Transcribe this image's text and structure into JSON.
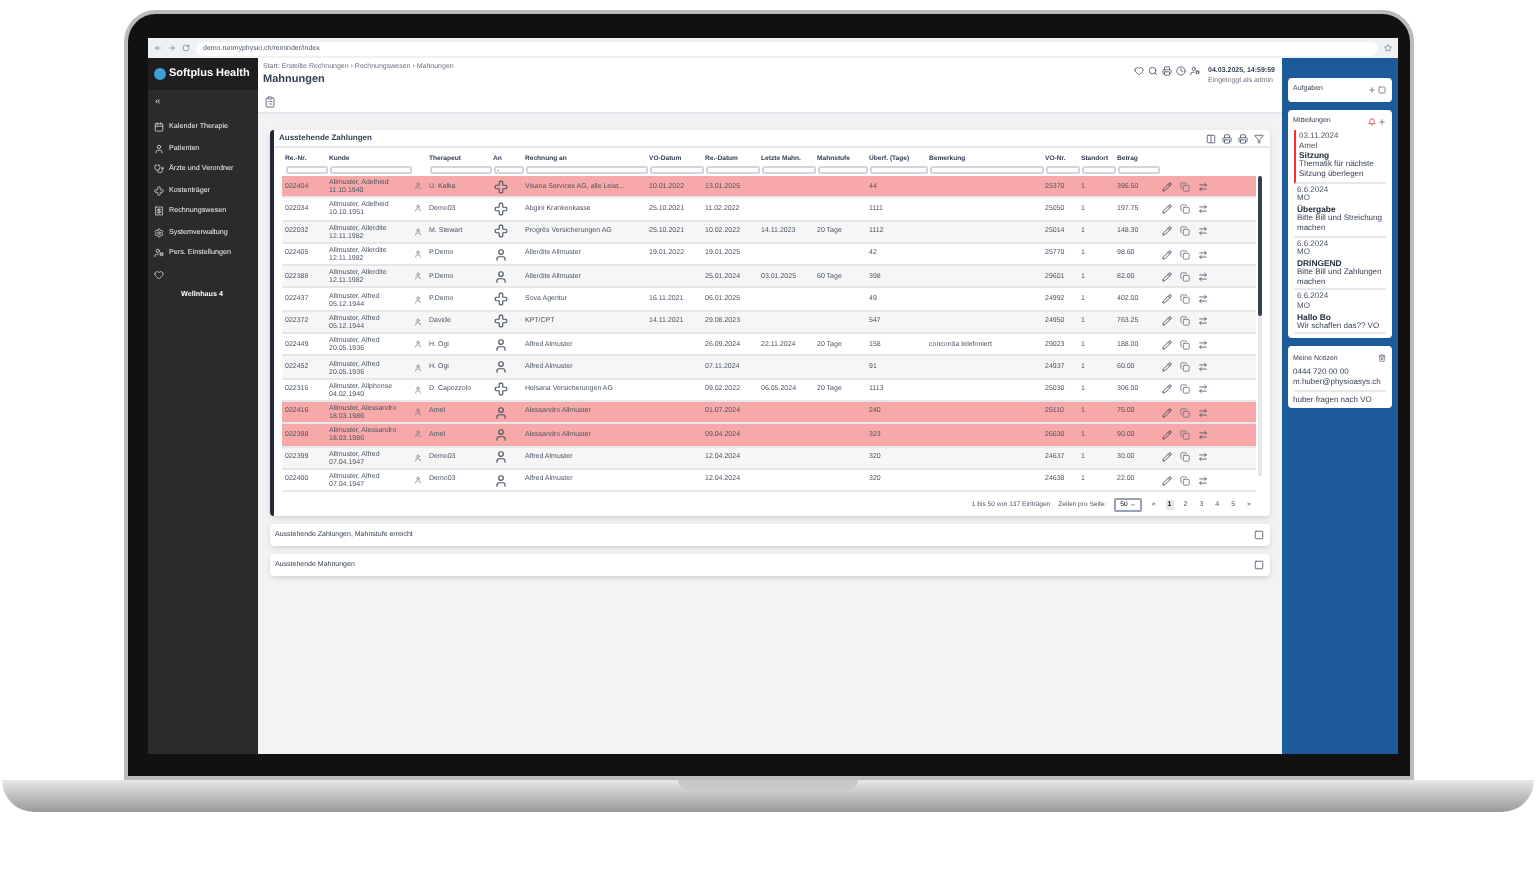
{
  "browser": {
    "url": "demo.runmyphysio.ch/reminder/index"
  },
  "sidebar": {
    "logo": "Softplus Health",
    "collapse": "«",
    "items": [
      {
        "label": "Kalender Therapie"
      },
      {
        "label": "Patienten"
      },
      {
        "label": "Ärzte und Verordner"
      },
      {
        "label": "Kostenträger"
      },
      {
        "label": "Rechnungswesen"
      },
      {
        "label": "Systemverwaltung"
      },
      {
        "label": "Pers. Einstellungen"
      }
    ],
    "footer": "Wellnhaus 4"
  },
  "header": {
    "breadcrumb": "Start: Erstellte Rechnungen › Rechnungswesen › Mahnungen",
    "title": "Mahnungen",
    "datetime": "04.03.2025, 14:59:59",
    "user": "Eingeloggt als admin"
  },
  "table_card": {
    "title": "Ausstehende Zahlungen",
    "columns": [
      "Re.-Nr.",
      "Kunde",
      "Therapeut",
      "An",
      "Rechnung an",
      "VO-Datum",
      "Re.-Datum",
      "Letzte Mahn.",
      "Mahnstufe",
      "Überf. (Tage)",
      "Bemerkung",
      "VO-Nr.",
      "Standort",
      "Betrag"
    ],
    "an_filter": "-",
    "rows": [
      {
        "nr": "022404",
        "name": "Allmuster, Adelheid",
        "birth": "11.10.1940",
        "therapist": "U. Kalka",
        "kind": "insurer",
        "recipient": "Visana Services AG, alle Leist...",
        "vo_date": "10.01.2022",
        "re_date": "13.01.2025",
        "days": "44",
        "vo_nr": "25370",
        "location": "1",
        "amount": "395.50",
        "overdue": true
      },
      {
        "nr": "022034",
        "name": "Allmuster, Adelheid",
        "birth": "10.10.1951",
        "therapist": "Demo03",
        "kind": "insurer",
        "recipient": "Abgini Krankenkasse",
        "vo_date": "25.10.2021",
        "re_date": "11.02.2022",
        "days": "1111",
        "vo_nr": "25050",
        "location": "1",
        "amount": "197.75",
        "overdue": false
      },
      {
        "nr": "022032",
        "name": "Allmuster, Allerdite",
        "birth": "12.11.1982",
        "therapist": "M. Stewart",
        "kind": "insurer",
        "recipient": "Progrès Versicherungen AG",
        "vo_date": "25.10.2021",
        "re_date": "10.02.2022",
        "last_reminder": "14.11.2023",
        "level": "20 Tage",
        "days": "1112",
        "vo_nr": "25014",
        "location": "1",
        "amount": "148.30",
        "overdue": false
      },
      {
        "nr": "022405",
        "name": "Allmuster, Allerdite",
        "birth": "12.11.1982",
        "therapist": "P.Demo",
        "kind": "patient",
        "recipient": "Allerdite Allmuster",
        "vo_date": "19.01.2022",
        "re_date": "19.01.2025",
        "days": "42",
        "vo_nr": "25770",
        "location": "1",
        "amount": "98.60",
        "overdue": false
      },
      {
        "nr": "022388",
        "name": "Allmuster, Allerdite",
        "birth": "12.11.1982",
        "therapist": "P.Demo",
        "kind": "patient",
        "recipient": "Allerdite Allmuster",
        "re_date": "25.01.2024",
        "last_reminder": "03.01.2025",
        "level": "60 Tage",
        "days": "398",
        "vo_nr": "29601",
        "location": "1",
        "amount": "82.00",
        "overdue": false
      },
      {
        "nr": "022437",
        "name": "Allmuster, Alfred",
        "birth": "05.12.1944",
        "therapist": "P.Demo",
        "kind": "insurer",
        "recipient": "Sova Agentur",
        "vo_date": "16.11.2021",
        "re_date": "06.01.2025",
        "days": "49",
        "vo_nr": "24992",
        "location": "1",
        "amount": "402.00",
        "overdue": false
      },
      {
        "nr": "022372",
        "name": "Allmuster, Alfred",
        "birth": "05.12.1944",
        "therapist": "Davide",
        "kind": "insurer",
        "recipient": "KPT/CPT",
        "vo_date": "14.11.2021",
        "re_date": "29.08.2023",
        "days": "547",
        "vo_nr": "24950",
        "location": "1",
        "amount": "763.25",
        "overdue": false
      },
      {
        "nr": "022449",
        "name": "Allmuster, Alfred",
        "birth": "20.05.1936",
        "therapist": "H. Ogi",
        "kind": "patient",
        "recipient": "Alfred Almuster",
        "re_date": "26.09.2024",
        "last_reminder": "22.11.2024",
        "level": "20 Tage",
        "days": "158",
        "remark": "concordia telefoniert",
        "vo_nr": "29023",
        "location": "1",
        "amount": "188.00",
        "overdue": false
      },
      {
        "nr": "022452",
        "name": "Allmuster, Alfred",
        "birth": "20.05.1936",
        "therapist": "H. Ogi",
        "kind": "patient",
        "recipient": "Alfred Almuster",
        "re_date": "07.11.2024",
        "days": "91",
        "vo_nr": "24937",
        "location": "1",
        "amount": "60.00",
        "overdue": false
      },
      {
        "nr": "022316",
        "name": "Allmuster, Allphonse",
        "birth": "04.02.1940",
        "therapist": "D. Capozzolo",
        "kind": "insurer",
        "recipient": "Helsana Versicherungen AG",
        "re_date": "09.02.2022",
        "last_reminder": "06.05.2024",
        "level": "20 Tage",
        "days": "1113",
        "vo_nr": "25030",
        "location": "1",
        "amount": "306.00",
        "overdue": false
      },
      {
        "nr": "022416",
        "name": "Allmuster, Alessandro",
        "birth": "18.03.1986",
        "therapist": "Amel",
        "kind": "patient",
        "recipient": "Alessandro Allmuster",
        "re_date": "01.07.2024",
        "days": "240",
        "vo_nr": "25110",
        "location": "1",
        "amount": "75.00",
        "overdue": true
      },
      {
        "nr": "022398",
        "name": "Allmuster, Alessandro",
        "birth": "18.03.1986",
        "therapist": "Amel",
        "kind": "patient",
        "recipient": "Alessandro Allmuster",
        "re_date": "09.04.2024",
        "days": "323",
        "vo_nr": "26630",
        "location": "1",
        "amount": "90.00",
        "overdue": true
      },
      {
        "nr": "022399",
        "name": "Allmuster, Alfred",
        "birth": "07.04.1947",
        "therapist": "Demo03",
        "kind": "patient",
        "recipient": "Alfred Almuster",
        "re_date": "12.04.2024",
        "days": "320",
        "vo_nr": "24637",
        "location": "1",
        "amount": "30.00",
        "overdue": false
      },
      {
        "nr": "022400",
        "name": "Allmuster, Alfred",
        "birth": "07.04.1947",
        "therapist": "Demo03",
        "kind": "patient",
        "recipient": "Alfred Almuster",
        "re_date": "12.04.2024",
        "days": "320",
        "vo_nr": "24638",
        "location": "1",
        "amount": "22.00",
        "overdue": false
      }
    ],
    "pagination": {
      "summary": "1 bis 50 von 137 Einträgen",
      "per_page_label": "Zeilen pro Seite:",
      "per_page": "50",
      "pages": [
        {
          "label": "«",
          "selected": false
        },
        {
          "label": "1",
          "selected": true
        },
        {
          "label": "2",
          "selected": false
        },
        {
          "label": "3",
          "selected": false
        },
        {
          "label": "4",
          "selected": false
        },
        {
          "label": "5",
          "selected": false
        },
        {
          "label": "»",
          "selected": false
        }
      ]
    }
  },
  "collapsed_cards": [
    {
      "title": "Ausstehende Zahlungen, Mahnstufe erreicht"
    },
    {
      "title": "Ausstehende Mahnungen"
    }
  ],
  "right_panel": {
    "tasks": {
      "title": "Aufgaben"
    },
    "messages": {
      "title": "Mitteilungen",
      "items": [
        {
          "date": "03.11.2024",
          "author": "Amel",
          "subject": "Sitzung",
          "text": "Thematik für nächste Sitzung überlegen",
          "highlighted": true
        },
        {
          "date": "6.6.2024",
          "author": "MO",
          "subject": "Übergabe",
          "text": "Bitte Bill und Streichung machen",
          "highlighted": false
        },
        {
          "date": "6.6.2024",
          "author": "MO",
          "subject": "DRINGEND",
          "text": "Bitte Bill und Zahlungen machen",
          "highlighted": false
        },
        {
          "date": "6.6.2024",
          "author": "MO",
          "subject": "Hallo Bo",
          "text": "Wir schaffen das?? VO",
          "highlighted": false
        }
      ]
    },
    "notes": {
      "title": "Meine Notizen",
      "lines": [
        "0444 720 00 00",
        "m.huber@physioasys.ch"
      ],
      "remark": "huber fragen nach VO"
    }
  }
}
